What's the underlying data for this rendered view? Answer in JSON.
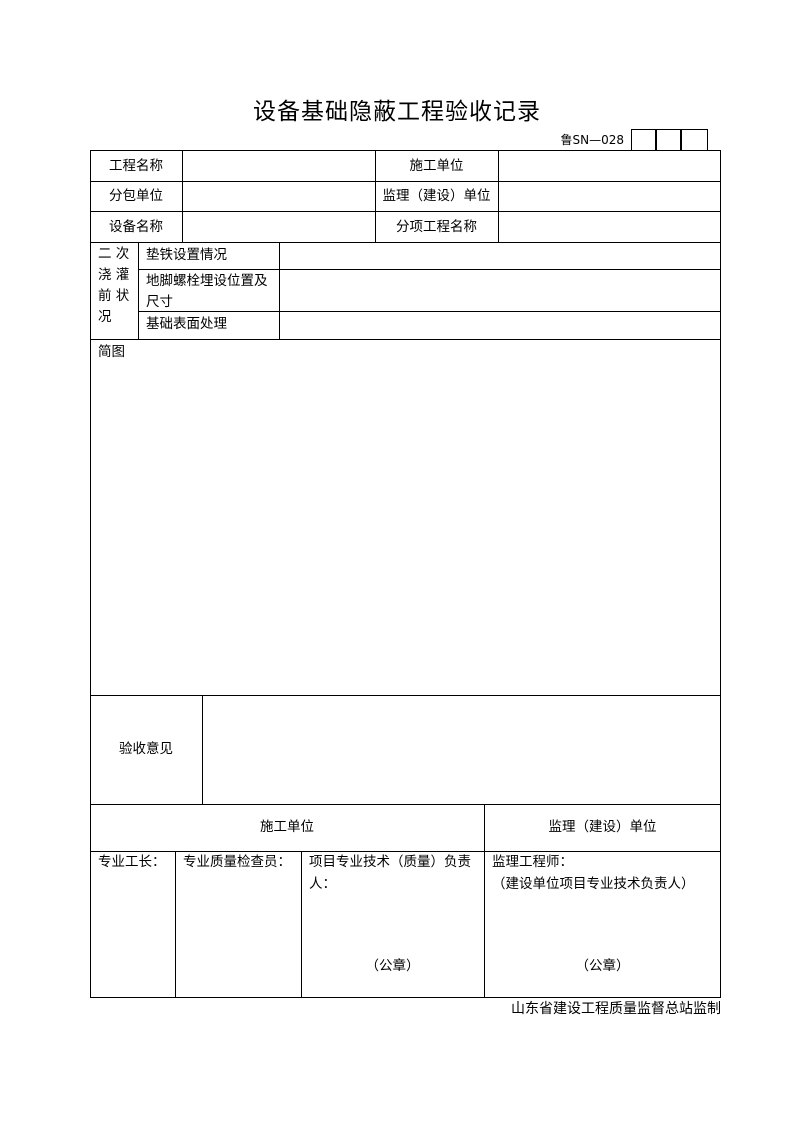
{
  "title": "设备基础隐蔽工程验收记录",
  "form_code": "鲁SN—028",
  "header_rows": [
    {
      "left_label": "工程名称",
      "left_value": "",
      "right_label": "施工单位",
      "right_value": ""
    },
    {
      "left_label": "分包单位",
      "left_value": "",
      "right_label": "监理（建设）单位",
      "right_value": ""
    },
    {
      "left_label": "设备名称",
      "left_value": "",
      "right_label": "分项工程名称",
      "right_value": ""
    }
  ],
  "pre_grouting": {
    "group_label_lines": [
      "二 次",
      "浇 灌",
      "前 状",
      "况"
    ],
    "items": [
      {
        "label": "垫铁设置情况",
        "value": ""
      },
      {
        "label_lines": [
          "地脚螺栓埋设位置及",
          "尺寸"
        ],
        "value": ""
      },
      {
        "label": "基础表面处理",
        "value": ""
      }
    ]
  },
  "sketch_label": "简图",
  "acceptance_opinion_label": "验收意见",
  "sign": {
    "contractor_header": "施工单位",
    "supervisor_header": "监理（建设）单位",
    "foreman": "专业工长：",
    "inspector": "专业质量检查员：",
    "tech_lead_lines": [
      "项目专业技术（质量）负责",
      "人："
    ],
    "seal_left": "（公章）",
    "supervisor_engineer": "监理工程师：",
    "owner_rep": "（建设单位项目专业技术负责人）",
    "seal_right": "（公章）"
  },
  "footer": "山东省建设工程质量监督总站监制"
}
